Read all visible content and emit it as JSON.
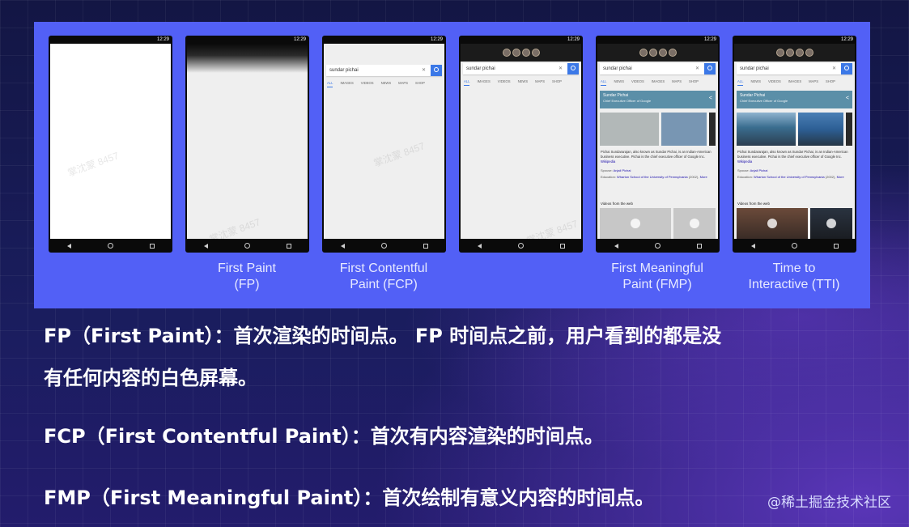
{
  "phones": [
    {
      "time": "12:29",
      "variant": "blank",
      "caption_line1": "",
      "caption_line2": ""
    },
    {
      "time": "12:29",
      "variant": "fade",
      "caption_line1": "First Paint",
      "caption_line2": "(FP)"
    },
    {
      "time": "12:29",
      "variant": "search",
      "search_text": "sundar pichai",
      "tabs": [
        "ALL",
        "IMAGES",
        "VIDEOS",
        "NEWS",
        "MAPS",
        "SHOP"
      ],
      "caption_line1": "First Contentful",
      "caption_line2": "Paint (FCP)"
    },
    {
      "time": "12:29",
      "variant": "search-doodle",
      "search_text": "sundar pichai",
      "tabs": [
        "ALL",
        "IMAGES",
        "VIDEOS",
        "NEWS",
        "MAPS",
        "SHOP"
      ],
      "caption_line1": "",
      "caption_line2": ""
    },
    {
      "time": "12:29",
      "variant": "knowledge-gray",
      "search_text": "sundar pichai",
      "tabs": [
        "ALL",
        "NEWS",
        "VIDEOS",
        "IMAGES",
        "MAPS",
        "SHOP"
      ],
      "caption_line1": "First Meaningful",
      "caption_line2": "Paint (FMP)"
    },
    {
      "time": "12:29",
      "variant": "knowledge-full",
      "search_text": "sundar pichai",
      "tabs": [
        "ALL",
        "NEWS",
        "VIDEOS",
        "IMAGES",
        "MAPS",
        "SHOP"
      ],
      "caption_line1": "Time to",
      "caption_line2": "Interactive (TTI)"
    }
  ],
  "knowledge_panel": {
    "name": "Sundar Pichai",
    "subtitle": "Chief Executive Officer of Google",
    "desc": "Pichai Sundararajan, also known as Sundar Pichai, is an Indian-American business executive. Pichai is the chief executive officer of Google Inc.",
    "desc_link": "Wikipedia",
    "spouse_label": "Spouse:",
    "spouse": "Anjali Pichai",
    "education_label": "Education:",
    "education": "Wharton School of the University of Pennsylvania",
    "education_tail": "(2002),",
    "more": "More",
    "videos_label": "Videos from the web"
  },
  "watermark": "掌沈蒙 8457",
  "paragraphs": {
    "fp_line1": "FP（First Paint）：首次渲染的时间点。 FP 时间点之前，用户看到的都是没",
    "fp_line2": "有任何内容的白色屏幕。",
    "fcp": "FCP（First Contentful Paint）：首次有内容渲染的时间点。",
    "fmp": "FMP（First Meaningful Paint）：首次绘制有意义内容的时间点。"
  },
  "credit": "@稀土掘金技术社区",
  "colors": {
    "panel": "#5260f6",
    "background": "#171a55",
    "search_button": "#3b78e7",
    "kp_header": "#5b8fa8"
  }
}
